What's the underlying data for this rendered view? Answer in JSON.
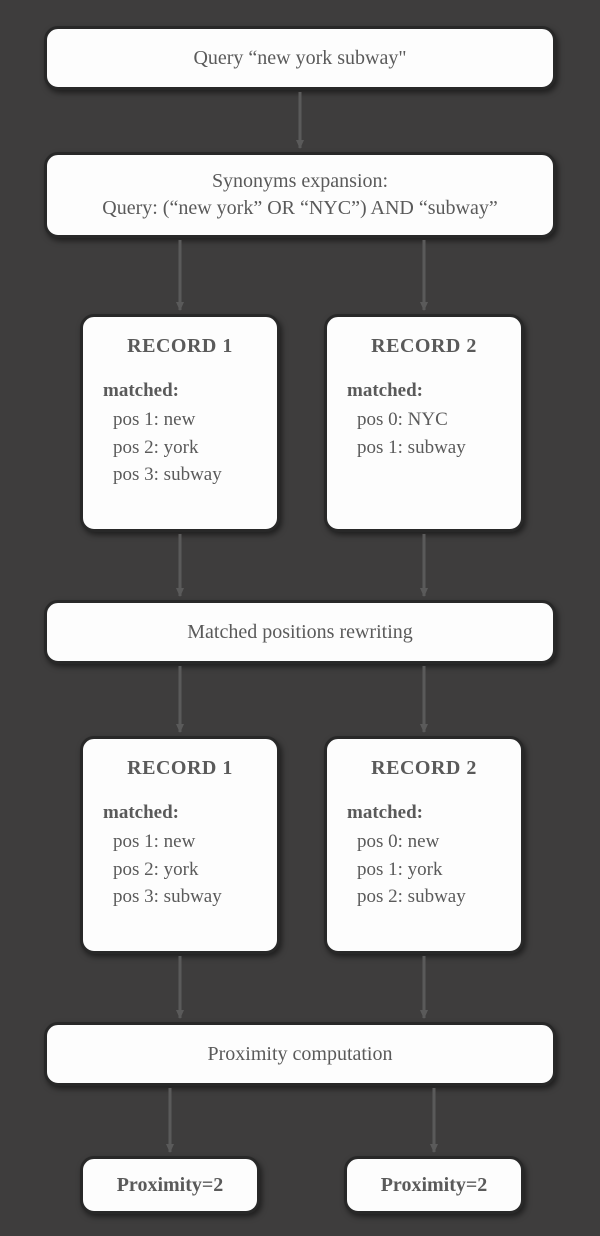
{
  "step1": {
    "text": "Query “new york subway\""
  },
  "step2": {
    "line1": "Synonyms expansion:",
    "line2": "Query: (“new york” OR “NYC”) AND “subway”"
  },
  "records_a": {
    "r1": {
      "title": "RECORD 1",
      "matched_label": "matched:",
      "positions": [
        "pos 1: new",
        "pos 2: york",
        "pos 3: subway"
      ]
    },
    "r2": {
      "title": "RECORD 2",
      "matched_label": "matched:",
      "positions": [
        "pos 0: NYC",
        "pos 1: subway"
      ]
    }
  },
  "step3": {
    "text": "Matched positions rewriting"
  },
  "records_b": {
    "r1": {
      "title": "RECORD 1",
      "matched_label": "matched:",
      "positions": [
        "pos 1: new",
        "pos 2: york",
        "pos 3: subway"
      ]
    },
    "r2": {
      "title": "RECORD 2",
      "matched_label": "matched:",
      "positions": [
        "pos 0: new",
        "pos 1: york",
        "pos 2: subway"
      ]
    }
  },
  "step4": {
    "text": "Proximity computation"
  },
  "results": {
    "p1": "Proximity=2",
    "p2": "Proximity=2"
  }
}
